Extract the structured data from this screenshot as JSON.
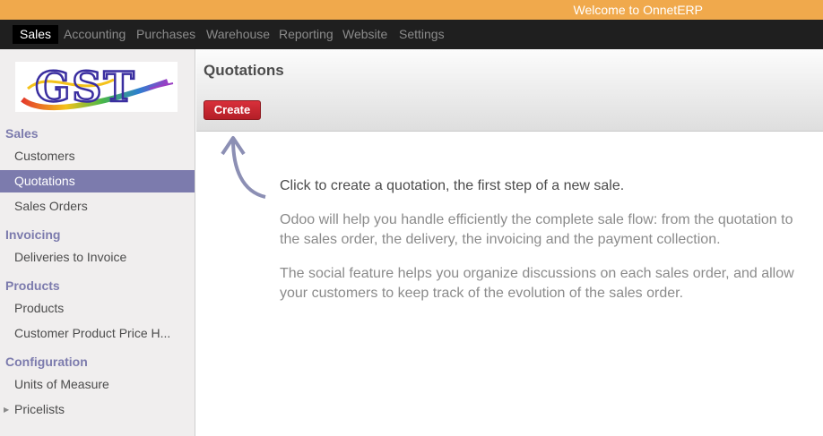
{
  "topbar": {
    "welcome": "Welcome to OnnetERP"
  },
  "menu": {
    "items": [
      {
        "label": "Sales",
        "active": true
      },
      {
        "label": "Accounting"
      },
      {
        "label": "Purchases"
      },
      {
        "label": "Warehouse"
      },
      {
        "label": "Reporting"
      },
      {
        "label": "Website"
      },
      {
        "label": "Settings"
      }
    ]
  },
  "logo": {
    "text": "GST"
  },
  "sidebar": {
    "sections": [
      {
        "title": "Sales",
        "items": [
          "Customers",
          "Quotations",
          "Sales Orders"
        ]
      },
      {
        "title": "Invoicing",
        "items": [
          "Deliveries to Invoice"
        ]
      },
      {
        "title": "Products",
        "items": [
          "Products",
          "Customer Product Price H..."
        ]
      },
      {
        "title": "Configuration",
        "items": [
          "Units of Measure",
          "Pricelists"
        ]
      }
    ],
    "selected": "Quotations"
  },
  "header": {
    "title": "Quotations",
    "create_label": "Create"
  },
  "help": {
    "lead": "Click to create a quotation, the first step of a new sale.",
    "para1": "Odoo will help you handle efficiently the complete sale flow: from the quotation to the sales order, the delivery, the invoicing and the payment collection.",
    "para2": "The social feature helps you organize discussions on each sales order, and allow your customers to keep track of the evolution of the sales order."
  },
  "colors": {
    "topbar": "#f0a94c",
    "menubar": "#1f1f1f",
    "accent": "#7c7bad",
    "create_button": "#c0272f"
  }
}
